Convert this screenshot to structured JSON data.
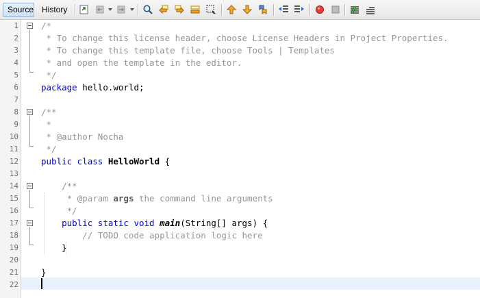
{
  "toolbar": {
    "tabs": [
      {
        "label": "Source",
        "active": true
      },
      {
        "label": "History",
        "active": false
      }
    ],
    "icons": [
      "last-edit-icon",
      "back-icon",
      "forward-icon",
      "find-icon",
      "find-prev-icon",
      "find-next-icon",
      "find-selection-icon",
      "toggle-highlight-icon",
      "toggle-rect-selection-icon",
      "prev-bookmark-icon",
      "next-bookmark-icon",
      "toggle-bookmark-icon",
      "shift-left-icon",
      "shift-right-icon",
      "start-macro-icon",
      "stop-macro-icon",
      "comment-icon",
      "uncomment-icon"
    ]
  },
  "editor": {
    "line_numbers": [
      "1",
      "2",
      "3",
      "4",
      "5",
      "6",
      "7",
      "8",
      "9",
      "10",
      "11",
      "12",
      "13",
      "14",
      "15",
      "16",
      "17",
      "18",
      "19",
      "20",
      "21",
      "22"
    ],
    "lines": {
      "l1": "/*",
      "l2": " * To change this license header, choose License Headers in Project Properties.",
      "l3": " * To change this template file, choose Tools | Templates",
      "l4": " * and open the template in the editor.",
      "l5": " */",
      "l6_kw": "package",
      "l6_rest": " hello.world;",
      "l8": "/**",
      "l9": " *",
      "l10_a": " * ",
      "l10_tag": "@author",
      "l10_b": " Nocha",
      "l11": " */",
      "l12_kw": "public class",
      "l12_sp": " ",
      "l12_name": "HelloWorld",
      "l12_rest": " {",
      "l14": "    /**",
      "l15_a": "     * ",
      "l15_tag": "@param",
      "l15_sp": " ",
      "l15_arg": "args",
      "l15_b": " the command line arguments",
      "l16": "     */",
      "l17_indent": "    ",
      "l17_kw": "public static void",
      "l17_sp": " ",
      "l17_name": "main",
      "l17_rest": "(String[] args) {",
      "l18": "        // TODO code application logic here",
      "l19": "    }",
      "l21": "}"
    },
    "colors": {
      "keyword": "#0000e6",
      "comment": "#969696",
      "current_line": "#e8f2fe"
    }
  }
}
